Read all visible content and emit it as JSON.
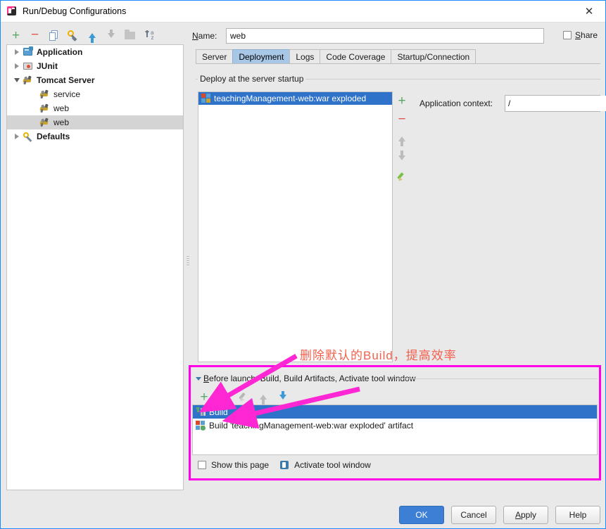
{
  "window": {
    "title": "Run/Debug Configurations",
    "close_label": "✕",
    "app_icon": "intellij-idea-icon"
  },
  "left_toolbar": {
    "items": [
      {
        "name": "add-configuration-button",
        "icon": "plus-icon",
        "label": "+"
      },
      {
        "name": "remove-configuration-button",
        "icon": "minus-icon",
        "label": "−"
      },
      {
        "name": "copy-configuration-button",
        "icon": "copy-icon",
        "label": ""
      },
      {
        "name": "edit-defaults-button",
        "icon": "wrench-icon",
        "label": ""
      },
      {
        "name": "move-up-button",
        "icon": "arrow-up-icon",
        "label": ""
      },
      {
        "name": "move-down-button",
        "icon": "arrow-down-icon",
        "label": ""
      },
      {
        "name": "new-folder-button",
        "icon": "folder-icon",
        "label": ""
      },
      {
        "name": "sort-alphabetically-button",
        "icon": "sort-az-icon",
        "label": ""
      }
    ]
  },
  "tree": {
    "items": [
      {
        "label": "Application",
        "icon": "application-icon",
        "expander": "collapsed",
        "indent": 0,
        "bold": true,
        "selected": false
      },
      {
        "label": "JUnit",
        "icon": "junit-icon",
        "expander": "collapsed",
        "indent": 0,
        "bold": true,
        "selected": false
      },
      {
        "label": "Tomcat Server",
        "icon": "tomcat-icon",
        "expander": "expanded",
        "indent": 0,
        "bold": true,
        "selected": false
      },
      {
        "label": "service",
        "icon": "tomcat-icon",
        "expander": "none",
        "indent": 1,
        "bold": false,
        "selected": false
      },
      {
        "label": "web",
        "icon": "tomcat-icon",
        "expander": "none",
        "indent": 1,
        "bold": false,
        "selected": false
      },
      {
        "label": "web",
        "icon": "tomcat-icon",
        "expander": "none",
        "indent": 1,
        "bold": false,
        "selected": true
      },
      {
        "label": "Defaults",
        "icon": "defaults-wrench-icon",
        "expander": "collapsed",
        "indent": 0,
        "bold": true,
        "selected": false
      }
    ]
  },
  "form": {
    "name_label": "Name:",
    "name_label_mnemonic": "N",
    "name_value": "web",
    "share_label": "Share",
    "share_mnemonic": "S",
    "share_checked": false
  },
  "tabs": {
    "items": [
      {
        "label": "Server",
        "active": false
      },
      {
        "label": "Deployment",
        "active": true
      },
      {
        "label": "Logs",
        "active": false
      },
      {
        "label": "Code Coverage",
        "active": false
      },
      {
        "label": "Startup/Connection",
        "active": false
      }
    ]
  },
  "deployment": {
    "group_label": "Deploy at the server startup",
    "artifacts": [
      {
        "label": "teachingManagement-web:war exploded",
        "icon": "artifact-icon",
        "selected": true
      }
    ],
    "toolbar": [
      {
        "name": "add-artifact-button",
        "icon": "plus-icon",
        "label": "+"
      },
      {
        "name": "remove-artifact-button",
        "icon": "minus-icon",
        "label": "−"
      },
      {
        "name": "move-artifact-up-button",
        "icon": "arrow-up-icon",
        "label": ""
      },
      {
        "name": "move-artifact-down-button",
        "icon": "arrow-down-icon",
        "label": ""
      },
      {
        "name": "edit-artifact-button",
        "icon": "pencil-icon",
        "label": ""
      }
    ],
    "application_context_label": "Application context:",
    "application_context_value": "/"
  },
  "before_launch": {
    "header": "Before launch: Build, Build Artifacts, Activate tool window",
    "header_mnemonic": "B",
    "toolbar": [
      {
        "name": "add-task-button",
        "icon": "plus-icon",
        "label": "+"
      },
      {
        "name": "remove-task-button",
        "icon": "minus-icon",
        "label": "−"
      },
      {
        "name": "edit-task-button",
        "icon": "pencil-icon",
        "label": ""
      },
      {
        "name": "move-task-up-button",
        "icon": "arrow-up-icon",
        "label": ""
      },
      {
        "name": "move-task-down-button",
        "icon": "arrow-down-icon",
        "label": ""
      }
    ],
    "tasks": [
      {
        "label": "Build",
        "icon": "build-icon",
        "selected": true
      },
      {
        "label": "Build 'teachingManagement-web:war exploded' artifact",
        "icon": "artifact-build-icon",
        "selected": false
      }
    ],
    "show_this_page_label": "Show this page",
    "show_this_page_checked": false,
    "activate_tool_window_label": "Activate tool window",
    "activate_tool_window_icon": "tool-window-icon"
  },
  "annotation": {
    "text": "删除默认的Build，提高效率",
    "text_color": "#f4604e",
    "rect_color": "#ff00e8",
    "arrow_color": "#ff27d4"
  },
  "buttons": [
    {
      "label": "OK",
      "primary": true,
      "name": "ok-button"
    },
    {
      "label": "Cancel",
      "primary": false,
      "name": "cancel-button"
    },
    {
      "label": "Apply",
      "primary": false,
      "name": "apply-button",
      "mnemonic": "A"
    },
    {
      "label": "Help",
      "primary": false,
      "name": "help-button"
    }
  ]
}
